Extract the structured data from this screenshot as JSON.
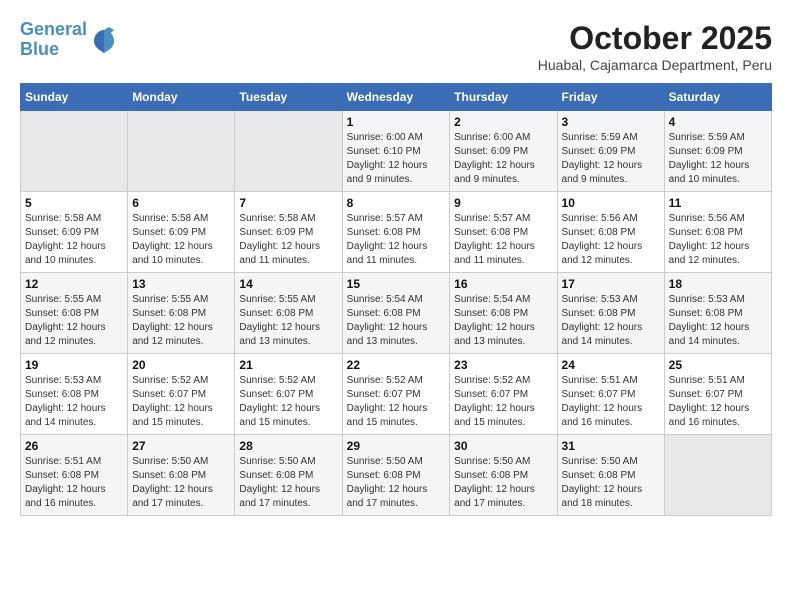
{
  "header": {
    "logo_line1": "General",
    "logo_line2": "Blue",
    "month": "October 2025",
    "location": "Huabal, Cajamarca Department, Peru"
  },
  "weekdays": [
    "Sunday",
    "Monday",
    "Tuesday",
    "Wednesday",
    "Thursday",
    "Friday",
    "Saturday"
  ],
  "weeks": [
    [
      {
        "num": "",
        "info": ""
      },
      {
        "num": "",
        "info": ""
      },
      {
        "num": "",
        "info": ""
      },
      {
        "num": "1",
        "info": "Sunrise: 6:00 AM\nSunset: 6:10 PM\nDaylight: 12 hours\nand 9 minutes."
      },
      {
        "num": "2",
        "info": "Sunrise: 6:00 AM\nSunset: 6:09 PM\nDaylight: 12 hours\nand 9 minutes."
      },
      {
        "num": "3",
        "info": "Sunrise: 5:59 AM\nSunset: 6:09 PM\nDaylight: 12 hours\nand 9 minutes."
      },
      {
        "num": "4",
        "info": "Sunrise: 5:59 AM\nSunset: 6:09 PM\nDaylight: 12 hours\nand 10 minutes."
      }
    ],
    [
      {
        "num": "5",
        "info": "Sunrise: 5:58 AM\nSunset: 6:09 PM\nDaylight: 12 hours\nand 10 minutes."
      },
      {
        "num": "6",
        "info": "Sunrise: 5:58 AM\nSunset: 6:09 PM\nDaylight: 12 hours\nand 10 minutes."
      },
      {
        "num": "7",
        "info": "Sunrise: 5:58 AM\nSunset: 6:09 PM\nDaylight: 12 hours\nand 11 minutes."
      },
      {
        "num": "8",
        "info": "Sunrise: 5:57 AM\nSunset: 6:08 PM\nDaylight: 12 hours\nand 11 minutes."
      },
      {
        "num": "9",
        "info": "Sunrise: 5:57 AM\nSunset: 6:08 PM\nDaylight: 12 hours\nand 11 minutes."
      },
      {
        "num": "10",
        "info": "Sunrise: 5:56 AM\nSunset: 6:08 PM\nDaylight: 12 hours\nand 12 minutes."
      },
      {
        "num": "11",
        "info": "Sunrise: 5:56 AM\nSunset: 6:08 PM\nDaylight: 12 hours\nand 12 minutes."
      }
    ],
    [
      {
        "num": "12",
        "info": "Sunrise: 5:55 AM\nSunset: 6:08 PM\nDaylight: 12 hours\nand 12 minutes."
      },
      {
        "num": "13",
        "info": "Sunrise: 5:55 AM\nSunset: 6:08 PM\nDaylight: 12 hours\nand 12 minutes."
      },
      {
        "num": "14",
        "info": "Sunrise: 5:55 AM\nSunset: 6:08 PM\nDaylight: 12 hours\nand 13 minutes."
      },
      {
        "num": "15",
        "info": "Sunrise: 5:54 AM\nSunset: 6:08 PM\nDaylight: 12 hours\nand 13 minutes."
      },
      {
        "num": "16",
        "info": "Sunrise: 5:54 AM\nSunset: 6:08 PM\nDaylight: 12 hours\nand 13 minutes."
      },
      {
        "num": "17",
        "info": "Sunrise: 5:53 AM\nSunset: 6:08 PM\nDaylight: 12 hours\nand 14 minutes."
      },
      {
        "num": "18",
        "info": "Sunrise: 5:53 AM\nSunset: 6:08 PM\nDaylight: 12 hours\nand 14 minutes."
      }
    ],
    [
      {
        "num": "19",
        "info": "Sunrise: 5:53 AM\nSunset: 6:08 PM\nDaylight: 12 hours\nand 14 minutes."
      },
      {
        "num": "20",
        "info": "Sunrise: 5:52 AM\nSunset: 6:07 PM\nDaylight: 12 hours\nand 15 minutes."
      },
      {
        "num": "21",
        "info": "Sunrise: 5:52 AM\nSunset: 6:07 PM\nDaylight: 12 hours\nand 15 minutes."
      },
      {
        "num": "22",
        "info": "Sunrise: 5:52 AM\nSunset: 6:07 PM\nDaylight: 12 hours\nand 15 minutes."
      },
      {
        "num": "23",
        "info": "Sunrise: 5:52 AM\nSunset: 6:07 PM\nDaylight: 12 hours\nand 15 minutes."
      },
      {
        "num": "24",
        "info": "Sunrise: 5:51 AM\nSunset: 6:07 PM\nDaylight: 12 hours\nand 16 minutes."
      },
      {
        "num": "25",
        "info": "Sunrise: 5:51 AM\nSunset: 6:07 PM\nDaylight: 12 hours\nand 16 minutes."
      }
    ],
    [
      {
        "num": "26",
        "info": "Sunrise: 5:51 AM\nSunset: 6:08 PM\nDaylight: 12 hours\nand 16 minutes."
      },
      {
        "num": "27",
        "info": "Sunrise: 5:50 AM\nSunset: 6:08 PM\nDaylight: 12 hours\nand 17 minutes."
      },
      {
        "num": "28",
        "info": "Sunrise: 5:50 AM\nSunset: 6:08 PM\nDaylight: 12 hours\nand 17 minutes."
      },
      {
        "num": "29",
        "info": "Sunrise: 5:50 AM\nSunset: 6:08 PM\nDaylight: 12 hours\nand 17 minutes."
      },
      {
        "num": "30",
        "info": "Sunrise: 5:50 AM\nSunset: 6:08 PM\nDaylight: 12 hours\nand 17 minutes."
      },
      {
        "num": "31",
        "info": "Sunrise: 5:50 AM\nSunset: 6:08 PM\nDaylight: 12 hours\nand 18 minutes."
      },
      {
        "num": "",
        "info": ""
      }
    ]
  ]
}
